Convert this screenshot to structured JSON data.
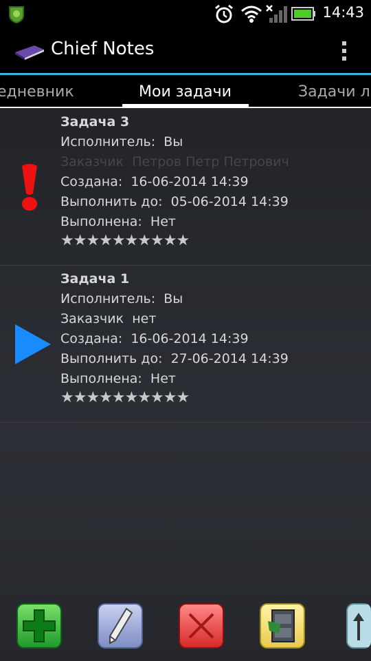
{
  "status_bar": {
    "time": "14:43"
  },
  "app": {
    "title": "Chief Notes"
  },
  "tabs": {
    "left": "едневник",
    "center": "Мои задачи",
    "right": "Задачи ли"
  },
  "tasks": [
    {
      "title": "Задача 3",
      "executor_label": "Исполнитель:",
      "executor": "Вы",
      "customer_label": "Заказчик",
      "customer": "Петров Петр Петрович",
      "created_label": "Создана:",
      "created": "16-06-2014 14:39",
      "due_label": "Выполнить до:",
      "due": "05-06-2014 14:39",
      "done_label": "Выполнена:",
      "done": "Нет",
      "stars": "★★★★★★★★★★",
      "icon": "exclamation-icon"
    },
    {
      "title": "Задача 1",
      "executor_label": "Исполнитель:",
      "executor": "Вы",
      "customer_label": "Заказчик",
      "customer": "нет",
      "created_label": "Создана:",
      "created": "16-06-2014 14:39",
      "due_label": "Выполнить до:",
      "due": "27-06-2014 14:39",
      "done_label": "Выполнена:",
      "done": "Нет",
      "stars": "★★★★★★★★★★",
      "icon": "play-triangle-icon"
    }
  ],
  "toolbar": [
    "add-icon",
    "edit-icon",
    "delete-icon",
    "archive-icon",
    "arrow-up-icon"
  ],
  "colors": {
    "accent_blue": "#33b5e5",
    "priority_red": "#ee1111",
    "play_blue": "#1a8cff"
  }
}
